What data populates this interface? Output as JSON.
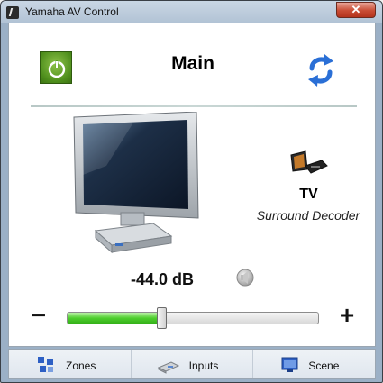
{
  "window": {
    "title": "Yamaha AV Control",
    "close_glyph": "✕"
  },
  "header": {
    "zone_name": "Main",
    "power_icon": "power-icon",
    "refresh_icon": "refresh-icon"
  },
  "status": {
    "input_name": "TV",
    "sound_mode": "Surround Decoder",
    "input_icon": "tv-input-icon"
  },
  "volume": {
    "readout": "-44.0 dB",
    "level": 0.38,
    "minus_label": "−",
    "plus_label": "+",
    "mute_icon": "mute-icon"
  },
  "tabs": [
    {
      "label": "Zones",
      "icon": "zones-icon"
    },
    {
      "label": "Inputs",
      "icon": "inputs-icon"
    },
    {
      "label": "Scene",
      "icon": "scene-icon"
    }
  ],
  "colors": {
    "power_green": "#5a9e22",
    "refresh_blue": "#2a6fd6",
    "slider_green": "#4fcf2e"
  }
}
